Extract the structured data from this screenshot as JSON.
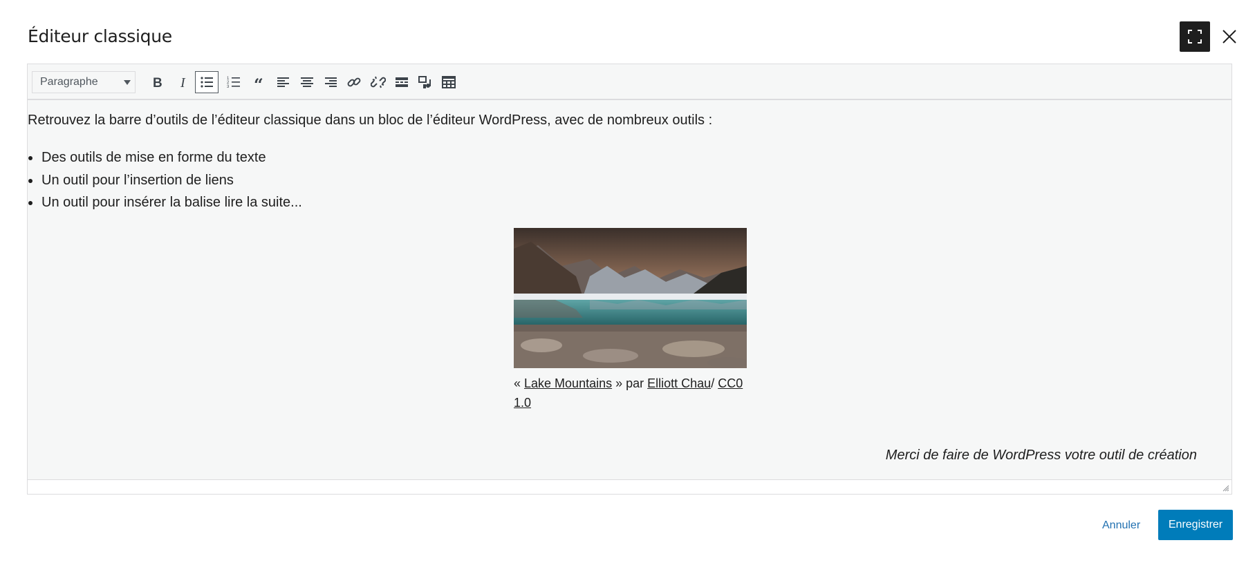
{
  "modal": {
    "title": "Éditeur classique",
    "fullscreen_icon": "fullscreen-icon",
    "close_icon": "close-icon"
  },
  "toolbar": {
    "format_select": {
      "value": "Paragraphe"
    },
    "buttons": [
      {
        "name": "bold",
        "icon": "bold-icon"
      },
      {
        "name": "italic",
        "icon": "italic-icon"
      },
      {
        "name": "bullet-list",
        "icon": "bullet-list-icon",
        "active": true
      },
      {
        "name": "numbered-list",
        "icon": "numbered-list-icon"
      },
      {
        "name": "blockquote",
        "icon": "quote-icon"
      },
      {
        "name": "align-left",
        "icon": "align-left-icon"
      },
      {
        "name": "align-center",
        "icon": "align-center-icon"
      },
      {
        "name": "align-right",
        "icon": "align-right-icon"
      },
      {
        "name": "insert-link",
        "icon": "link-icon"
      },
      {
        "name": "remove-link",
        "icon": "unlink-icon"
      },
      {
        "name": "read-more",
        "icon": "read-more-icon"
      },
      {
        "name": "add-media",
        "icon": "add-media-icon"
      },
      {
        "name": "toolbar-toggle",
        "icon": "toolbar-toggle-icon"
      }
    ]
  },
  "content": {
    "intro": "Retrouvez la barre d’outils de l’éditeur classique dans un bloc de l’éditeur WordPress, avec de nombreux outils :",
    "bullets": [
      "Des outils de mise en forme du texte",
      "Un outil pour l’insertion de liens",
      "Un outil pour insérer la balise lire la suite..."
    ],
    "figure": {
      "caption_prefix": "« ",
      "caption_link1": "Lake Mountains",
      "caption_mid": " » par ",
      "caption_link2": "Elliott Chau",
      "caption_sep": "/ ",
      "caption_link3": "CC0 1.0"
    },
    "thanks": "Merci de faire de WordPress votre outil de création"
  },
  "footer": {
    "cancel_label": "Annuler",
    "save_label": "Enregistrer"
  },
  "colors": {
    "accent": "#007cba",
    "link": "#2271b1",
    "editor_bg": "#f6f7f7",
    "dark_button": "#1e1e1e"
  }
}
